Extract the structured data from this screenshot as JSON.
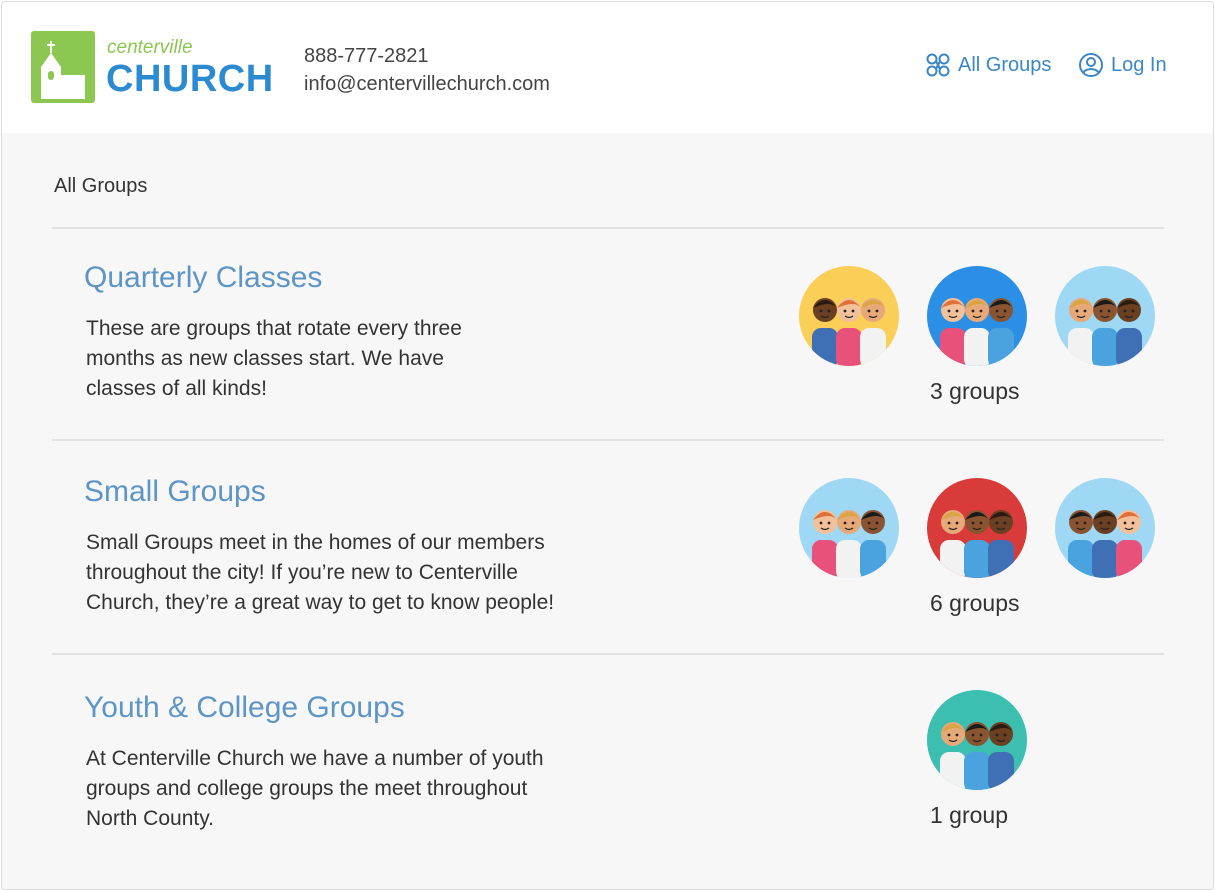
{
  "header": {
    "logo": {
      "small": "centerville",
      "big": "CHURCH"
    },
    "phone": "888-777-2821",
    "email": "info@centervillechurch.com",
    "nav": {
      "all_groups": "All Groups",
      "log_in": "Log In"
    }
  },
  "breadcrumb": "All Groups",
  "sections": [
    {
      "title": "Quarterly Classes",
      "desc_lines": [
        "These are groups that rotate every three",
        "months as new classes start. We have",
        "classes of all kinds!"
      ],
      "count": "3 groups",
      "avatars": [
        "#f9cf57",
        "#2b8fe6",
        "#9fd8f5"
      ]
    },
    {
      "title": "Small Groups",
      "desc_lines": [
        "Small Groups meet in the homes of our members",
        "throughout the city! If you’re new to Centerville",
        "Church, they’re a great way to get to know people!"
      ],
      "count": "6 groups",
      "avatars": [
        "#9fd8f5",
        "#d93b3b",
        "#9fd8f5"
      ]
    },
    {
      "title": "Youth & College Groups",
      "desc_lines": [
        "At Centerville Church we have a number of youth",
        "groups and college groups the meet throughout",
        "North County."
      ],
      "count": "1 group",
      "avatars": [
        "#3cbfb0"
      ]
    }
  ],
  "colors": {
    "brand_green": "#8cc752",
    "brand_blue": "#2b8ad0",
    "link": "#5c95c6"
  }
}
